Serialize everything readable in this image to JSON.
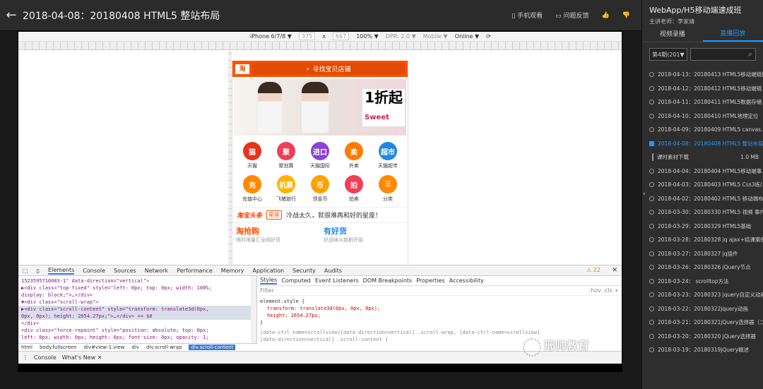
{
  "topbar": {
    "back_icon": "arrow-left-icon",
    "title": "2018-04-08：20180408 HTML5 整站布局",
    "mobile_watch": "手机观看",
    "feedback": "问题反馈"
  },
  "emulator": {
    "device": "iPhone 6/7/8 ▼",
    "width": "375",
    "x": "x",
    "height": "667",
    "zoom": "100% ▼",
    "dpr": "DPR: 2.0 ▼",
    "mode": "Mobile ▼",
    "network": "Online ▼"
  },
  "phone": {
    "logo": "淘",
    "search": "寻找宝贝店铺",
    "banner_sale": "1折起",
    "banner_sub": "Sweet",
    "grid": [
      {
        "label": "天猫",
        "glyph": "猫",
        "color": "#e8321d"
      },
      {
        "label": "聚划算",
        "glyph": "聚",
        "color": "#ef3f56"
      },
      {
        "label": "天猫国际",
        "glyph": "进口",
        "color": "#8a42d6"
      },
      {
        "label": "外卖",
        "glyph": "卖",
        "color": "#ff7a00"
      },
      {
        "label": "天猫超市",
        "glyph": "超市",
        "color": "#1e88e5"
      },
      {
        "label": "充值中心",
        "glyph": "充",
        "color": "#ff8a00"
      },
      {
        "label": "飞猪旅行",
        "glyph": "机票",
        "color": "#ffb300"
      },
      {
        "label": "领金币",
        "glyph": "币",
        "color": "#ffa200"
      },
      {
        "label": "拍卖",
        "glyph": "拍",
        "color": "#ef3f56"
      },
      {
        "label": "分类",
        "glyph": "☰",
        "color": "#ff8a00"
      }
    ],
    "toutiao_brand": "淘宝头条",
    "toutiao_tag": "星座",
    "toutiao_text": "冷战太久，就很难再和好的星座！",
    "promo1_title": "淘抢购",
    "promo1_sub": "限时限量汇全网好货",
    "promo2_title": "有好货",
    "promo2_sub": "好品味从挑剔开始"
  },
  "devtools": {
    "tabs": [
      "Elements",
      "Console",
      "Sources",
      "Network",
      "Performance",
      "Memory",
      "Application",
      "Security",
      "Audits"
    ],
    "warnings": "⚠ 22",
    "el_lines": [
      "1523595710083-1\" data-direction=\"vertical\">",
      "▶<div class=\"top-fixed\" style=\"left: 0px; top: 0px; width: 100%;",
      "display: block;\">…</div>",
      "▼<div class=\"scroll-wrap\">",
      "▶<div class=\"scroll-content\" style=\"transform: translate3d(0px,",
      "0px, 0px); height: 2654.27px;\">…</div> == $0",
      "</div>",
      "<div class=\"force-repaint\" style=\"position: absolute; top: 0px;",
      "left: 0px; width: 0px; height: 0px; font-size: 0px; opacity: 1;"
    ],
    "style_tabs": [
      "Styles",
      "Computed",
      "Event Listeners",
      "DOM Breakpoints",
      "Properties",
      "Accessibility"
    ],
    "filter": "Filter",
    "filter_right": ":hov  .cls  +",
    "style_selector": "element.style {",
    "style_prop1": "transform: translate3d(0px, 0px, 0px);",
    "style_prop2": "height: 2654.27px;",
    "style_close": "}",
    "style_rule": "[data-ctrl-name=scrollview][data-direction=vertical] .scroll-wrap, [data-ctrl-name=scrollview]",
    "style_rule2": "[data-direction=vertical] .scroll-content {",
    "crumbs": [
      "html",
      "body.fullscreen",
      "div#view-1.view",
      "div",
      "div.scroll-wrap",
      "div.scroll-content"
    ],
    "drawer": [
      "Console",
      "What's New ✕"
    ]
  },
  "sidebar": {
    "course": "WebApp/H5移动端速成班",
    "teacher": "主讲老师：李家靖",
    "tab_video": "视频录播",
    "tab_live": "直播回放",
    "period": "第4期(201▼",
    "items": [
      "2018-04-13：20180413 HTML5移动端链接",
      "2018-04-12：20180412 HTML5移动端链",
      "2018-04-11：20180411 HTML5数据存储",
      "2018-04-10：20180410 HTML地理定位",
      "2018-04-09：20180409 HTML5 canvas...",
      "2018-04-08：20180408 HTML5 整站布局",
      "2018-04-04：20180404 HTML5移动端事...",
      "2018-04-03：20180403 HTML5 Css3练(...",
      "2018-04-02：20180402 HTML5 移动端布局",
      "2018-03-30：20180330 HTML5 视频 事件",
      "2018-03-29：20180329 HTML5基础",
      "2018-03-28：20180328 jq ajax+结课案例",
      "2018-03-27：20180327 jq插件",
      "2018-03-26：20180326 jQuery节点",
      "2018-03-24： scrolltop方法",
      "2018-03-23：20180323 jquery自定义动画",
      "2018-03-22：20180322jquery动画",
      "2018-03-21：20180321jQuery选择器（二...",
      "2018-03-20：20180320 jQuery选择器",
      "2018-03-19：20180319jQuery概述"
    ],
    "sub_label": "课时素材下载",
    "sub_size": "1.0 MB"
  },
  "watermark": {
    "name": "邢帅教育",
    "url": "www.xsteach.com"
  }
}
